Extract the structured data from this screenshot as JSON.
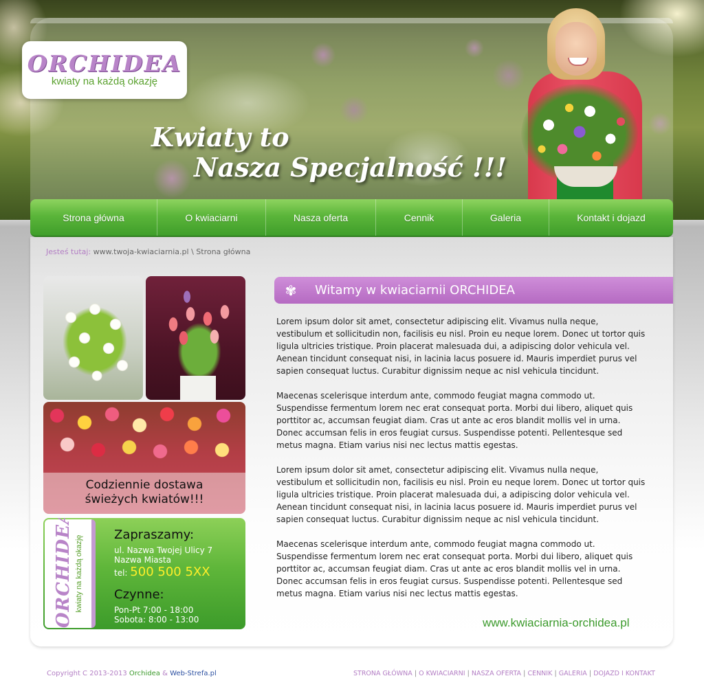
{
  "logo": {
    "name": "ORCHIDEA",
    "tagline": "kwiaty na każdą okazję"
  },
  "header": {
    "slogan_line1": "Kwiaty to",
    "slogan_line2": "Nasza Specjalność !!!"
  },
  "nav": {
    "items": [
      {
        "label": "Strona główna"
      },
      {
        "label": "O kwiaciarni"
      },
      {
        "label": "Nasza oferta"
      },
      {
        "label": "Cennik"
      },
      {
        "label": "Galeria"
      },
      {
        "label": "Kontakt i dojazd"
      }
    ]
  },
  "breadcrumb": {
    "label": "Jesteś tutaj:",
    "path": "www.twoja-kwiaciarnia.pl \\ Strona główna"
  },
  "sidebar": {
    "promo_line1": "Codziennie dostawa",
    "promo_line2": "świeżych kwiatów!!!",
    "contact": {
      "logo_name": "ORCHIDEA",
      "logo_tagline": "kwiaty na każdą okazję",
      "invite": "Zapraszamy:",
      "street": "ul. Nazwa Twojej Ulicy 7",
      "city": "Nazwa Miasta",
      "tel_label": "tel:",
      "phone": "500 500 5XX",
      "hours_title": "Czynne:",
      "hours_weekday": "Pon-Pt 7:00 - 18:00",
      "hours_saturday": "Sobota: 8:00 - 13:00"
    }
  },
  "main": {
    "heading": "Witamy w kwiaciarnii ORCHIDEA",
    "paragraphs": [
      "Lorem ipsum dolor sit amet, consectetur adipiscing elit. Vivamus nulla neque, vestibulum et sollicitudin non, facilisis eu nisl. Proin eu neque lorem. Donec ut tortor quis ligula ultricies tristique. Proin placerat malesuada dui, a adipiscing dolor vehicula vel. Aenean tincidunt consequat nisi, in lacinia lacus posuere id. Mauris imperdiet purus vel sapien consequat luctus. Curabitur dignissim neque ac nisl vehicula tincidunt.",
      "Maecenas scelerisque interdum ante, commodo feugiat magna commodo ut. Suspendisse fermentum lorem nec erat consequat porta. Morbi dui libero, aliquet quis porttitor ac, accumsan feugiat diam. Cras ut ante ac eros blandit mollis vel in urna. Donec accumsan felis in eros feugiat cursus. Suspendisse potenti. Pellentesque sed metus magna. Etiam varius nisi nec lectus mattis egestas.",
      "Lorem ipsum dolor sit amet, consectetur adipiscing elit. Vivamus nulla neque, vestibulum et sollicitudin non, facilisis eu nisl. Proin eu neque lorem. Donec ut tortor quis ligula ultricies tristique. Proin placerat malesuada dui, a adipiscing dolor vehicula vel. Aenean tincidunt consequat nisi, in lacinia lacus posuere id. Mauris imperdiet purus vel sapien consequat luctus. Curabitur dignissim neque ac nisl vehicula tincidunt.",
      "Maecenas scelerisque interdum ante, commodo feugiat magna commodo ut. Suspendisse fermentum lorem nec erat consequat porta. Morbi dui libero, aliquet quis porttitor ac, accumsan feugiat diam. Cras ut ante ac eros blandit mollis vel in urna. Donec accumsan felis in eros feugiat cursus. Suspendisse potenti. Pellentesque sed metus magna. Etiam varius nisi nec lectus mattis egestas."
    ],
    "site_url": "www.kwiaciarnia-orchidea.pl"
  },
  "footer": {
    "copyright_prefix": "Copyright C 2013-2013",
    "brand": "Orchidea",
    "amp": "&",
    "partner": "Web-Strefa.pl",
    "nav": [
      "STRONA GŁÓWNA",
      "O KWIACIARNI",
      "NASZA OFERTA",
      "CENNIK",
      "GALERIA",
      "DOJAZD I KONTAKT"
    ],
    "separator": "|"
  },
  "colors": {
    "accent_green": "#5bb53a",
    "accent_purple": "#b884c8",
    "phone_yellow": "#ffef2a"
  },
  "icons": {
    "heading_icon": "flower-icon"
  }
}
